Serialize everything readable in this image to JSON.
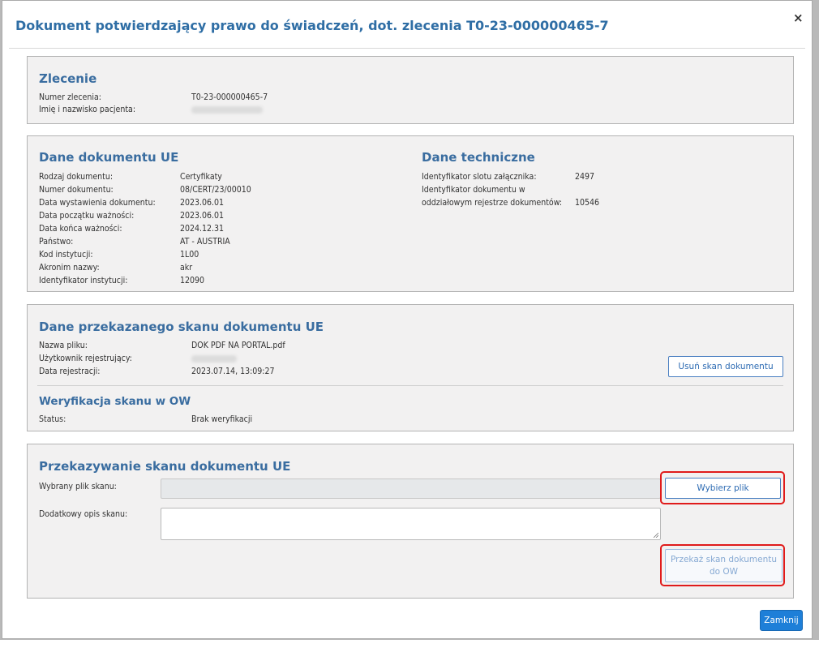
{
  "dialog": {
    "title": "Dokument potwierdzający prawo do świadczeń, dot. zlecenia T0-23-000000465-7",
    "close_label": "×",
    "close_button_label": "Zamknij"
  },
  "zlecenie": {
    "heading": "Zlecenie",
    "rows": [
      {
        "label": "Numer zlecenia:",
        "value": "T0-23-000000465-7"
      },
      {
        "label": "Imię i nazwisko pacjenta:",
        "value": ""
      }
    ]
  },
  "dane_ue": {
    "heading": "Dane dokumentu UE",
    "rows": [
      {
        "label": "Rodzaj dokumentu:",
        "value": "Certyfikaty"
      },
      {
        "label": "Numer dokumentu:",
        "value": "08/CERT/23/00010"
      },
      {
        "label": "Data wystawienia dokumentu:",
        "value": "2023.06.01"
      },
      {
        "label": "Data początku ważności:",
        "value": "2023.06.01"
      },
      {
        "label": "Data końca ważności:",
        "value": "2024.12.31"
      },
      {
        "label": "Państwo:",
        "value": "AT - AUSTRIA"
      },
      {
        "label": "Kod instytucji:",
        "value": "1L00"
      },
      {
        "label": "Akronim nazwy:",
        "value": "akr"
      },
      {
        "label": "Identyfikator instytucji:",
        "value": "12090"
      }
    ]
  },
  "dane_techniczne": {
    "heading": "Dane techniczne",
    "slot_label": "Identyfikator slotu załącznika:",
    "slot_value": "2497",
    "doc_label_1": "Identyfikator dokumentu w",
    "doc_label_2": "oddziałowym rejestrze dokumentów:",
    "doc_value": "10546"
  },
  "skan": {
    "heading": "Dane przekazanego skanu dokumentu UE",
    "rows": [
      {
        "label": "Nazwa pliku:",
        "value": "DOK PDF NA PORTAL.pdf"
      },
      {
        "label": "Użytkownik rejestrujący:",
        "value": ""
      },
      {
        "label": "Data rejestracji:",
        "value": "2023.07.14, 13:09:27"
      }
    ],
    "delete_button": "Usuń skan dokumentu",
    "weryfikacja_heading": "Weryfikacja skanu w OW",
    "status_label": "Status:",
    "status_value": "Brak weryfikacji"
  },
  "przekazywanie": {
    "heading": "Przekazywanie skanu dokumentu UE",
    "file_label": "Wybrany plik skanu:",
    "file_value": "",
    "choose_button": "Wybierz plik",
    "desc_label": "Dodatkowy opis skanu:",
    "desc_value": "",
    "submit_button_line1": "Przekaż skan dokumentu",
    "submit_button_line2": "do OW"
  },
  "colors": {
    "heading": "#3a6da0",
    "title": "#2f6ea5",
    "highlight": "#e01b1b",
    "primary": "#1e7fd8"
  }
}
